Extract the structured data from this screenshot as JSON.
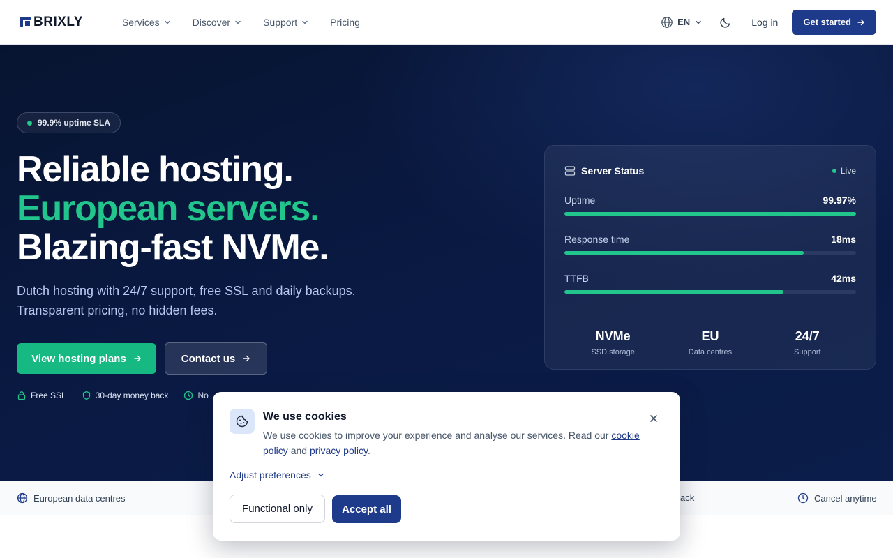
{
  "brand": {
    "name": "BRIXLY",
    "color": "#1e3a8a"
  },
  "nav": {
    "links": [
      {
        "label": "Services",
        "has_dropdown": true
      },
      {
        "label": "Discover",
        "has_dropdown": true
      },
      {
        "label": "Support",
        "has_dropdown": true
      },
      {
        "label": "Pricing",
        "has_dropdown": false
      }
    ],
    "language": "EN",
    "login_label": "Log in",
    "cta_label": "Get started"
  },
  "hero": {
    "badge": "99.9% uptime SLA",
    "headline": {
      "line1": "Reliable hosting.",
      "line2": "European servers.",
      "line3": "Blazing-fast NVMe."
    },
    "subtitle": {
      "line1": "Dutch hosting with 24/7 support, free SSL and daily backups.",
      "line2": "Transparent pricing, no hidden fees."
    },
    "primary_button": "View hosting plans",
    "secondary_button": "Contact us",
    "features": [
      {
        "icon": "lock-icon",
        "label": "Free SSL"
      },
      {
        "icon": "shield-icon",
        "label": "30-day money back"
      },
      {
        "icon": "clock-icon",
        "label": "No"
      }
    ],
    "accent_color": "#22c58b"
  },
  "status_card": {
    "title": "Server Status",
    "live_label": "Live",
    "metrics": [
      {
        "label": "Uptime",
        "value": "99.97%",
        "fill_percent": 100
      },
      {
        "label": "Response time",
        "value": "18ms",
        "fill_percent": 82
      },
      {
        "label": "TTFB",
        "value": "42ms",
        "fill_percent": 75
      }
    ],
    "stats": [
      {
        "value": "NVMe",
        "label": "SSD storage"
      },
      {
        "value": "EU",
        "label": "Data centres"
      },
      {
        "value": "24/7",
        "label": "Support"
      }
    ]
  },
  "trust_strip": {
    "left": "European data centres",
    "partial": "ack",
    "right": "Cancel anytime"
  },
  "cookie_banner": {
    "title": "We use cookies",
    "text_before": "We use cookies to improve your experience and analyse our services. Read our",
    "cookie_link": "cookie policy",
    "and": "and",
    "privacy_link": "privacy policy",
    "end": ".",
    "adjust_label": "Adjust preferences",
    "functional_button": "Functional only",
    "accept_button": "Accept all"
  }
}
